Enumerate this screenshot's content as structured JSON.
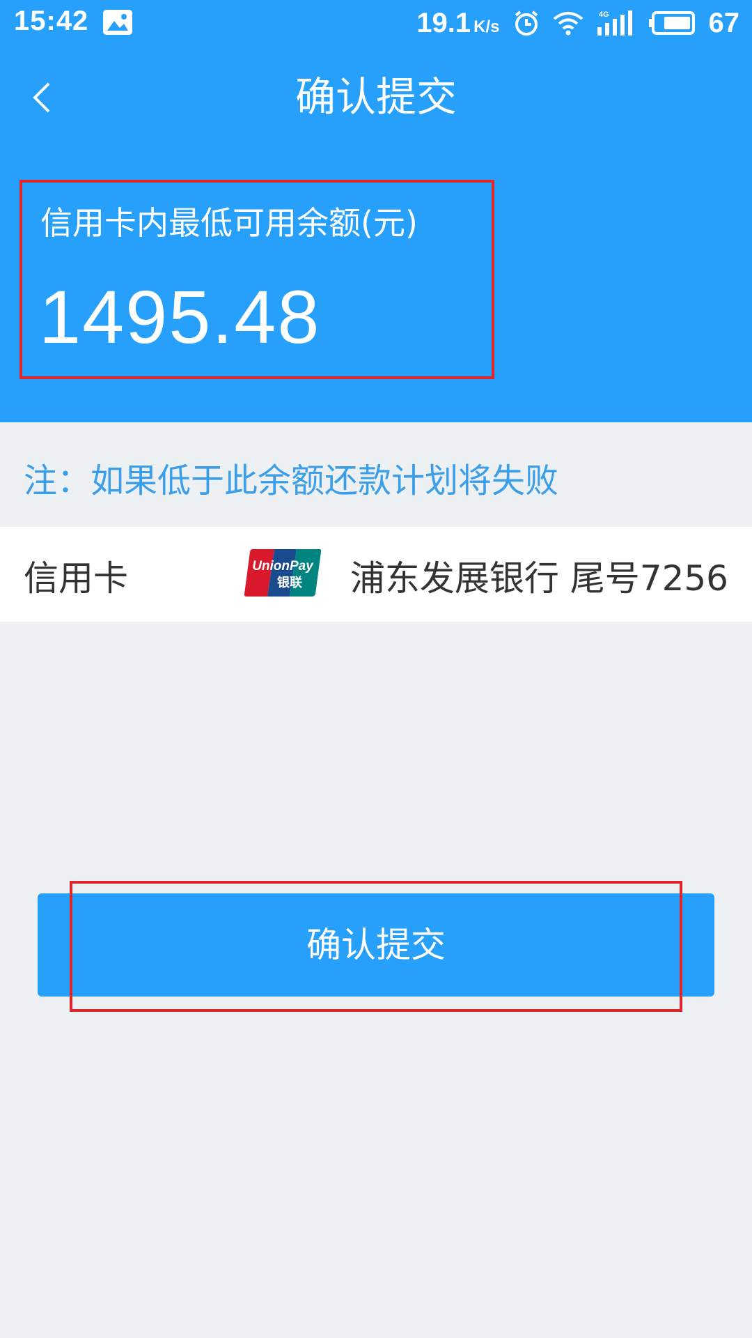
{
  "status_bar": {
    "time": "15:42",
    "speed": "19.1",
    "speed_unit": "K/s",
    "network": "4G",
    "battery": "67"
  },
  "nav": {
    "title": "确认提交"
  },
  "balance": {
    "label": "信用卡内最低可用余额(元)",
    "value": "1495.48"
  },
  "note": "注：如果低于此余额还款计划将失败",
  "card": {
    "label": "信用卡",
    "logo_text_top": "UnionPay",
    "logo_text_bottom": "银联",
    "bank": "浦东发展银行 尾号7256"
  },
  "confirm_button": {
    "label": "确认提交"
  },
  "colors": {
    "primary": "#26a0fa",
    "highlight": "#e0262d",
    "note": "#3a9ee8",
    "background": "#eef1f4"
  }
}
